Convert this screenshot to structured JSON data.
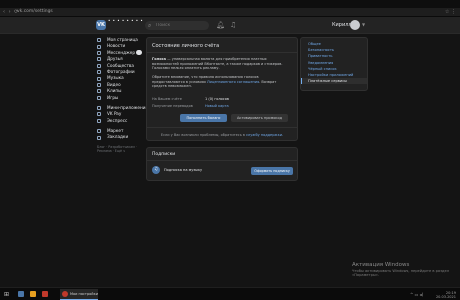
{
  "browser": {
    "url": "vk.com/settings",
    "nav_glyphs": "‹ › ⟳",
    "ext_glyphs": "☆ ⋮"
  },
  "header": {
    "logo_text": "VK",
    "logo_dots": "• • • • • • • •",
    "search_placeholder": "Поиск",
    "user_name": "Кирилл"
  },
  "sidebar": {
    "items": [
      {
        "label": "Моя страница"
      },
      {
        "label": "Новости"
      },
      {
        "label": "Мессенджер",
        "badge": true
      },
      {
        "label": "Друзья"
      },
      {
        "label": "Сообщества"
      },
      {
        "label": "Фотографии"
      },
      {
        "label": "Музыка"
      },
      {
        "label": "Видео"
      },
      {
        "label": "Клипы"
      },
      {
        "label": "Игры"
      }
    ],
    "items2": [
      {
        "label": "Мини-приложения"
      },
      {
        "label": "VK Pay"
      },
      {
        "label": "Экспресс"
      }
    ],
    "items3": [
      {
        "label": "Маркет"
      },
      {
        "label": "Закладки"
      }
    ],
    "footer": "Блог · Разработчикам · Реклама · Ещё ∨"
  },
  "payment": {
    "title": "Состояние личного счёта",
    "p1_bold": "Голоса",
    "p1_text": " — универсальная валюта для приобретения платных возможностей приложений ВКонтакте, а также подарков и стикеров. Голосами нельзя оплатить рекламу.",
    "p2_text": "Обратите внимание, что правила использования голосов предоставляются в условиях ",
    "p2_link": "Лицензионного соглашения",
    "p2_end": ". Возврат средств невозможен.",
    "balance_label": "На Вашем счёте",
    "balance_value": "1 (0) голосов",
    "transfers_label": "Получение переводов",
    "transfers_value": "Новый карта",
    "topup_button": "Пополнить баланс",
    "promo_button": "Активировать промокод",
    "help_text": "Если у Вас возникли проблемы, обратитесь в ",
    "help_link": "службу поддержки."
  },
  "settings_menu": {
    "items": [
      {
        "label": "Общее",
        "active": false
      },
      {
        "label": "Безопасность",
        "active": false
      },
      {
        "label": "Приватность",
        "active": false
      },
      {
        "label": "Уведомления",
        "active": false
      },
      {
        "label": "Чёрный список",
        "active": false
      },
      {
        "label": "Настройки приложений",
        "active": false
      },
      {
        "label": "Платёжные сервисы",
        "active": true
      }
    ]
  },
  "subscriptions": {
    "title": "Подписки",
    "item_icon": "♫",
    "item_label": "Подписка на музыку",
    "button": "Оформить подписку"
  },
  "watermark": {
    "line1": "Активация Windows",
    "line2": "Чтобы активировать Windows, перейдите в раздел «Параметры»."
  },
  "taskbar": {
    "start_glyph": "⊞",
    "active_window": "Мои настройки",
    "tray_time": "20:19",
    "tray_date": "20.03.2021",
    "tray_icons": "^ ▭ ◂)"
  }
}
